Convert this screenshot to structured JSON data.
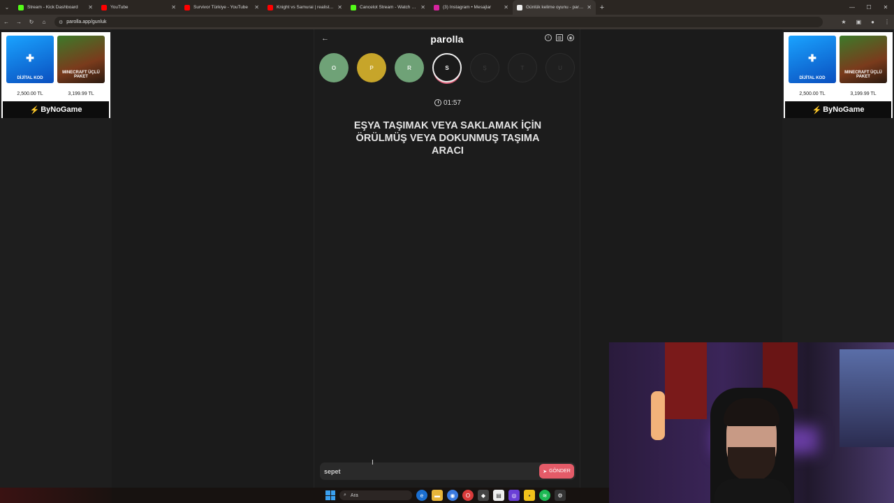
{
  "browser": {
    "tabs": [
      {
        "title": "Stream - Kick Dashboard",
        "color": "#53fc18",
        "icon": "kick-icon"
      },
      {
        "title": "YouTube",
        "color": "#ff0000",
        "icon": "youtube-icon"
      },
      {
        "title": "Survivor Türkiye - YouTube",
        "color": "#ff0000",
        "icon": "youtube-icon"
      },
      {
        "title": "Knight vs Samurai | realistic, m",
        "color": "#ff0000",
        "icon": "youtube-icon"
      },
      {
        "title": "Cancelot Stream - Watch Live o",
        "color": "#53fc18",
        "icon": "kick-icon"
      },
      {
        "title": "(3) Instagram • Mesajlar",
        "color": "#d6249f",
        "icon": "instagram-icon"
      },
      {
        "title": "Günlük kelime oyunu - parolla",
        "color": "#eeeeee",
        "icon": "parolla-icon"
      }
    ],
    "active_tab": 6,
    "url": "parolla.app/gunluk"
  },
  "ads": {
    "left": {
      "p1_price": "2,500.00 TL",
      "p2_price": "3,199.99 TL",
      "p1_label": "DİJİTAL KOD",
      "p2_label": "MINECRAFT ÜÇLÜ PAKET",
      "brand": "ByNoGame"
    },
    "right": {
      "p1_price": "2,500.00 TL",
      "p2_price": "3,199.99 TL",
      "p1_label": "DİJİTAL KOD",
      "p2_label": "MINECRAFT ÜÇLÜ PAKET",
      "brand": "ByNoGame"
    }
  },
  "game": {
    "logo": "parolla",
    "letters": [
      {
        "char": "O",
        "state": "green"
      },
      {
        "char": "P",
        "state": "yellow"
      },
      {
        "char": "R",
        "state": "green"
      },
      {
        "char": "S",
        "state": "current"
      },
      {
        "char": "Ş",
        "state": "upcoming"
      },
      {
        "char": "T",
        "state": "upcoming"
      },
      {
        "char": "U",
        "state": "upcoming"
      }
    ],
    "timer": "01:57",
    "question": "EŞYA TAŞIMAK VEYA SAKLAMAK İÇİN ÖRÜLMÜŞ VEYA DOKUNMUŞ TAŞIMA ARACI",
    "answer_value": "sepet",
    "send_label": "GÖNDER"
  },
  "taskbar": {
    "search_label": "Ara"
  }
}
